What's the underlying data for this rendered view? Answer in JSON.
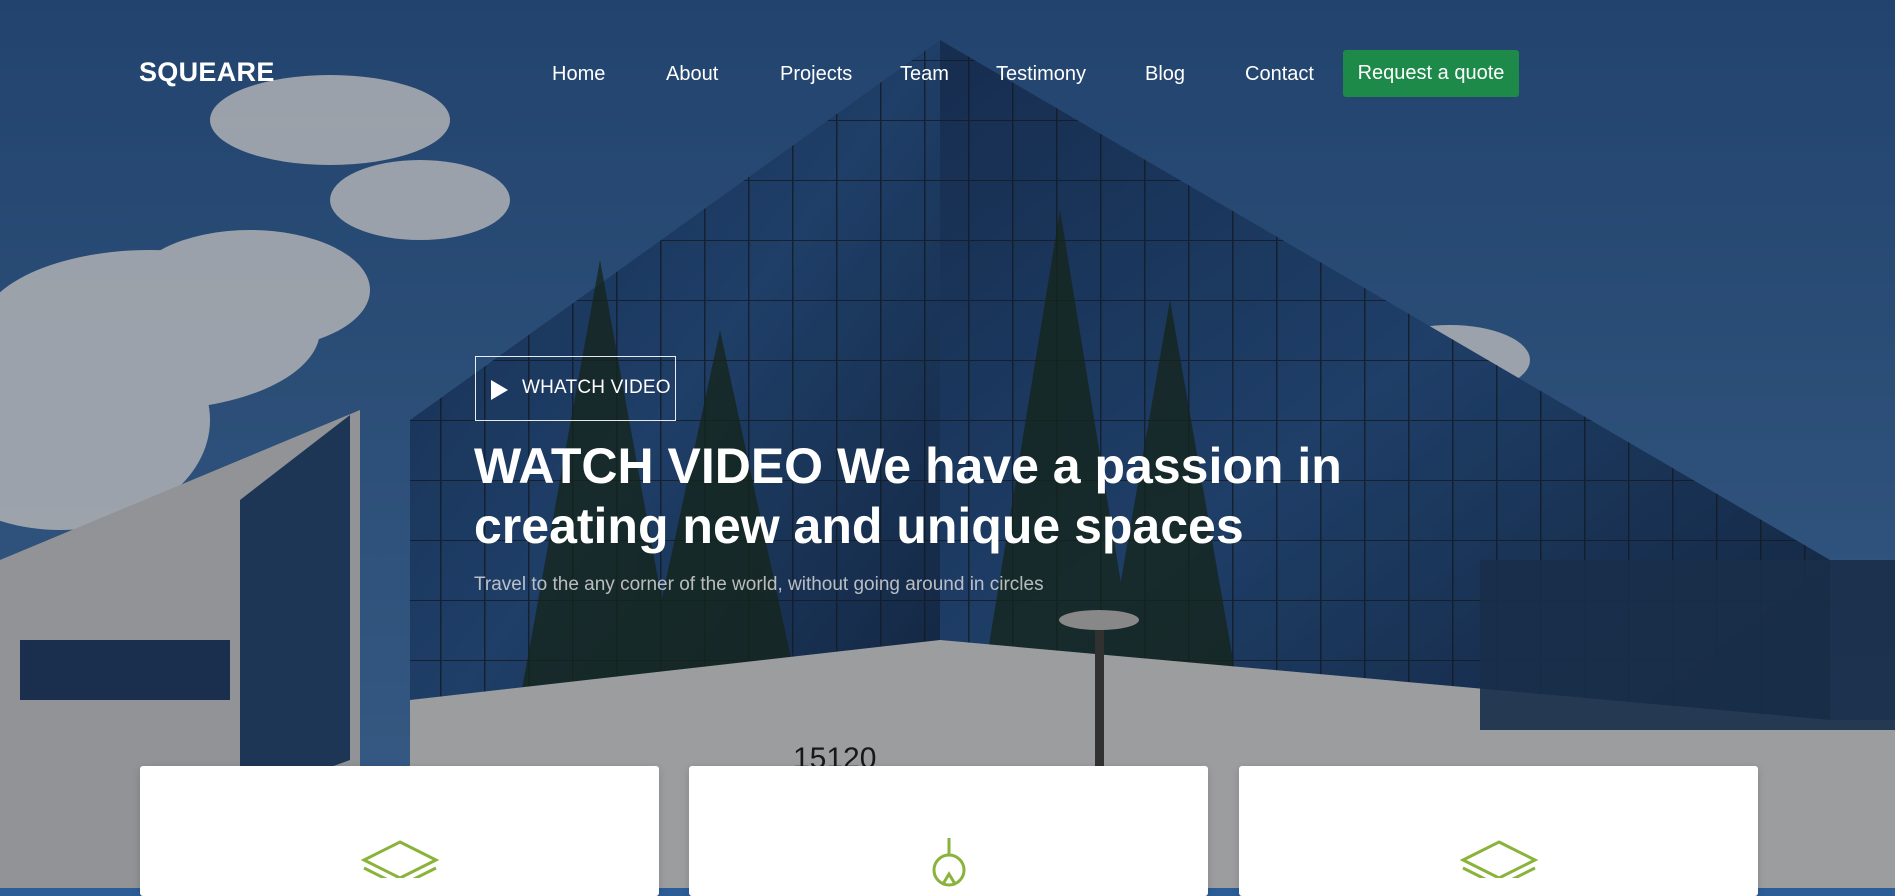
{
  "brand": {
    "name": "SQUEARE"
  },
  "nav": {
    "items": [
      {
        "label": "Home"
      },
      {
        "label": "About"
      },
      {
        "label": "Projects"
      },
      {
        "label": "Team"
      },
      {
        "label": "Testimony"
      },
      {
        "label": "Blog"
      },
      {
        "label": "Contact"
      }
    ],
    "cta_label": "Request a quote"
  },
  "hero": {
    "video_button_label": "WHATCH VIDEO",
    "headline": "WATCH VIDEO We have a passion in creating new and unique spaces",
    "subheadline": "Travel to the any corner of the world, without going around in circles",
    "building_number": "15120",
    "background": "glass office building against a blue sky with clouds"
  },
  "features": {
    "cards": [
      {
        "icon": "layers-icon"
      },
      {
        "icon": "lightbulb-icon"
      },
      {
        "icon": "layers-icon"
      }
    ]
  },
  "colors": {
    "accent": "#1e8a4a",
    "icon_stroke": "#8ab33a",
    "text_light": "#ffffff",
    "sky": "#2d5d96"
  }
}
